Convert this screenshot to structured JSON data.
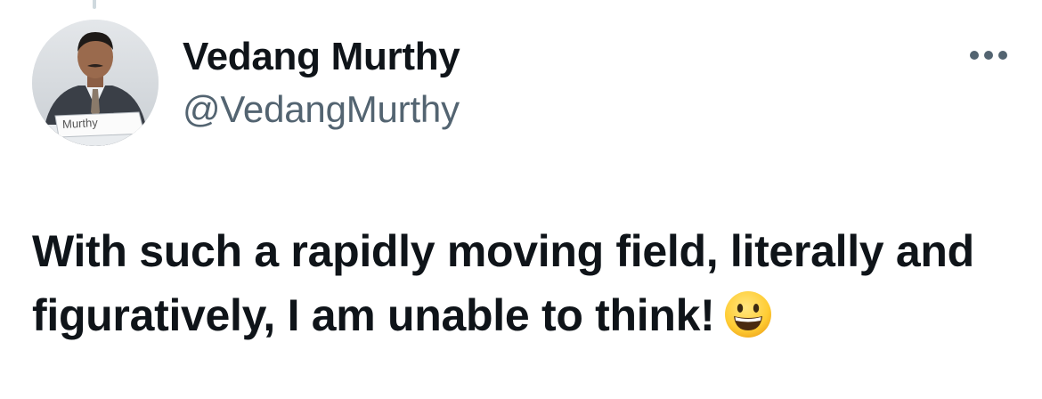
{
  "author": {
    "display_name": "Vedang Murthy",
    "handle": "@VedangMurthy",
    "avatar_icon": "profile-photo",
    "avatar_nameplate_text": "Murthy"
  },
  "menu": {
    "more_icon": "more-horizontal-icon"
  },
  "tweet": {
    "text": "With such a rapidly moving field, literally and figuratively, I am unable to think!",
    "emoji": "grinning-face-emoji"
  },
  "colors": {
    "text_primary": "#0f1419",
    "text_secondary": "#536471",
    "thread_line": "#cfd9de"
  }
}
